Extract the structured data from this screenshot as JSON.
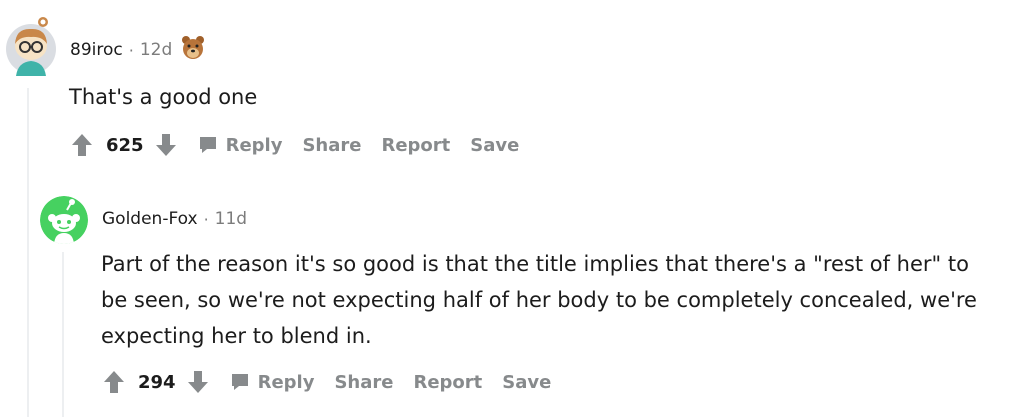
{
  "comments": [
    {
      "username": "89iroc",
      "separator": "·",
      "age": "12d",
      "body": "That's a good one",
      "score": "625",
      "actions": {
        "reply": "Reply",
        "share": "Share",
        "report": "Report",
        "save": "Save"
      },
      "award_icon": "bear-award-icon"
    },
    {
      "username": "Golden-Fox",
      "separator": "·",
      "age": "11d",
      "body_lines": [
        "Part of the reason it's so good is that the title implies that there's a \"rest of her\" to",
        "be seen, so we're not expecting half of her body to be completely concealed, we're",
        "expecting her to blend in."
      ],
      "score": "294",
      "actions": {
        "reply": "Reply",
        "share": "Share",
        "report": "Report",
        "save": "Save"
      }
    }
  ],
  "colors": {
    "action_gray": "#878a8c",
    "thread_line": "#edeff1",
    "avatar_green": "#46d160"
  }
}
